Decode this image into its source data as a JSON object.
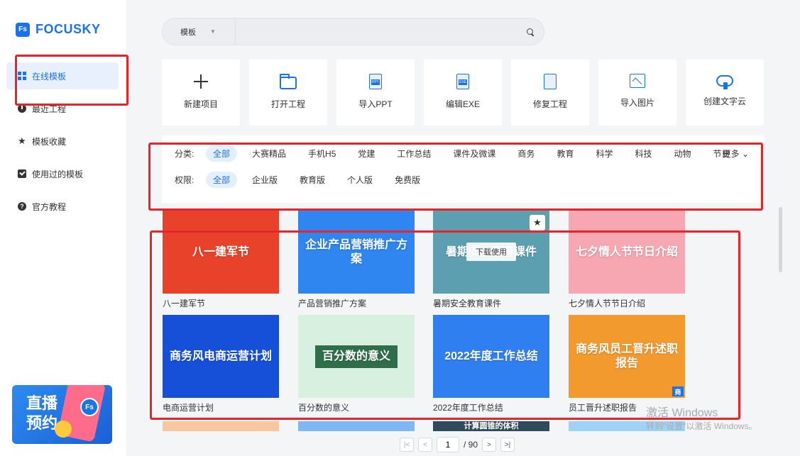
{
  "app": {
    "logo_badge": "Fs",
    "logo_text": "FOCUSKY"
  },
  "sidebar": {
    "items": [
      {
        "label": "在线模板",
        "icon": "grid-icon",
        "active": true
      },
      {
        "label": "最近工程",
        "icon": "clock-icon"
      },
      {
        "label": "模板收藏",
        "icon": "star-icon"
      },
      {
        "label": "使用过的模板",
        "icon": "check-icon"
      },
      {
        "label": "官方教程",
        "icon": "help-icon"
      }
    ],
    "promo": {
      "text": "直播预约",
      "badge": "Fs"
    }
  },
  "search": {
    "scope": "模板",
    "placeholder": ""
  },
  "actions": [
    {
      "label": "新建项目",
      "icon": "plus-icon"
    },
    {
      "label": "打开工程",
      "icon": "folder-icon"
    },
    {
      "label": "导入PPT",
      "icon": "ppt-file-icon",
      "tag": "PPT"
    },
    {
      "label": "编辑EXE",
      "icon": "exe-file-icon",
      "tag": "EXE"
    },
    {
      "label": "修复工程",
      "icon": "repair-icon"
    },
    {
      "label": "导入图片",
      "icon": "image-icon"
    },
    {
      "label": "创建文字云",
      "icon": "cloud-icon"
    }
  ],
  "filters": {
    "category": {
      "title": "分类:",
      "options": [
        "全部",
        "大赛精品",
        "手机H5",
        "党建",
        "工作总结",
        "课件及微课",
        "商务",
        "教育",
        "科学",
        "科技",
        "动物",
        "节日"
      ],
      "selected": "全部",
      "more": "更多"
    },
    "permission": {
      "title": "权限:",
      "options": [
        "全部",
        "企业版",
        "教育版",
        "个人版",
        "免费版"
      ],
      "selected": "全部"
    }
  },
  "templates": [
    {
      "title": "八一建军节",
      "thumb_text": "八一建军节",
      "bg": "#e8432a"
    },
    {
      "title": "产品营销推广方案",
      "thumb_text": "企业产品营销推广方案",
      "bg": "#2f86f0"
    },
    {
      "title": "暑期安全教育课件",
      "thumb_text": "暑期安全教育课件",
      "bg": "#5c9fb0",
      "hover_label": "下载使用"
    },
    {
      "title": "七夕情人节节日介绍",
      "thumb_text": "七夕情人节节日介绍",
      "bg": "#f6a7b2"
    },
    {
      "title": "电商运营计划",
      "thumb_text": "商务风电商运营计划",
      "bg": "#1650d8"
    },
    {
      "title": "百分数的意义",
      "thumb_text": "百分数的意义",
      "bg": "#d8f0e0"
    },
    {
      "title": "2022年度工作总结",
      "thumb_text": "2022年度工作总结",
      "bg": "#2f7ff0"
    },
    {
      "title": "员工晋升述职报告",
      "thumb_text": "商务风员工晋升述职报告",
      "bg": "#f29a2e",
      "badge": "商"
    }
  ],
  "peek_cards": [
    {
      "bg": "#f8c7a0"
    },
    {
      "bg": "#7fb7f5"
    },
    {
      "bg": "#2f4a5a",
      "thumb_text": "计算圆锥的体积"
    },
    {
      "bg": "#9fd3f5"
    }
  ],
  "pager": {
    "current": "1",
    "total": "/ 90"
  },
  "watermark": {
    "line1": "激活 Windows",
    "line2": "转到\"设置\"以激活 Windows。"
  }
}
